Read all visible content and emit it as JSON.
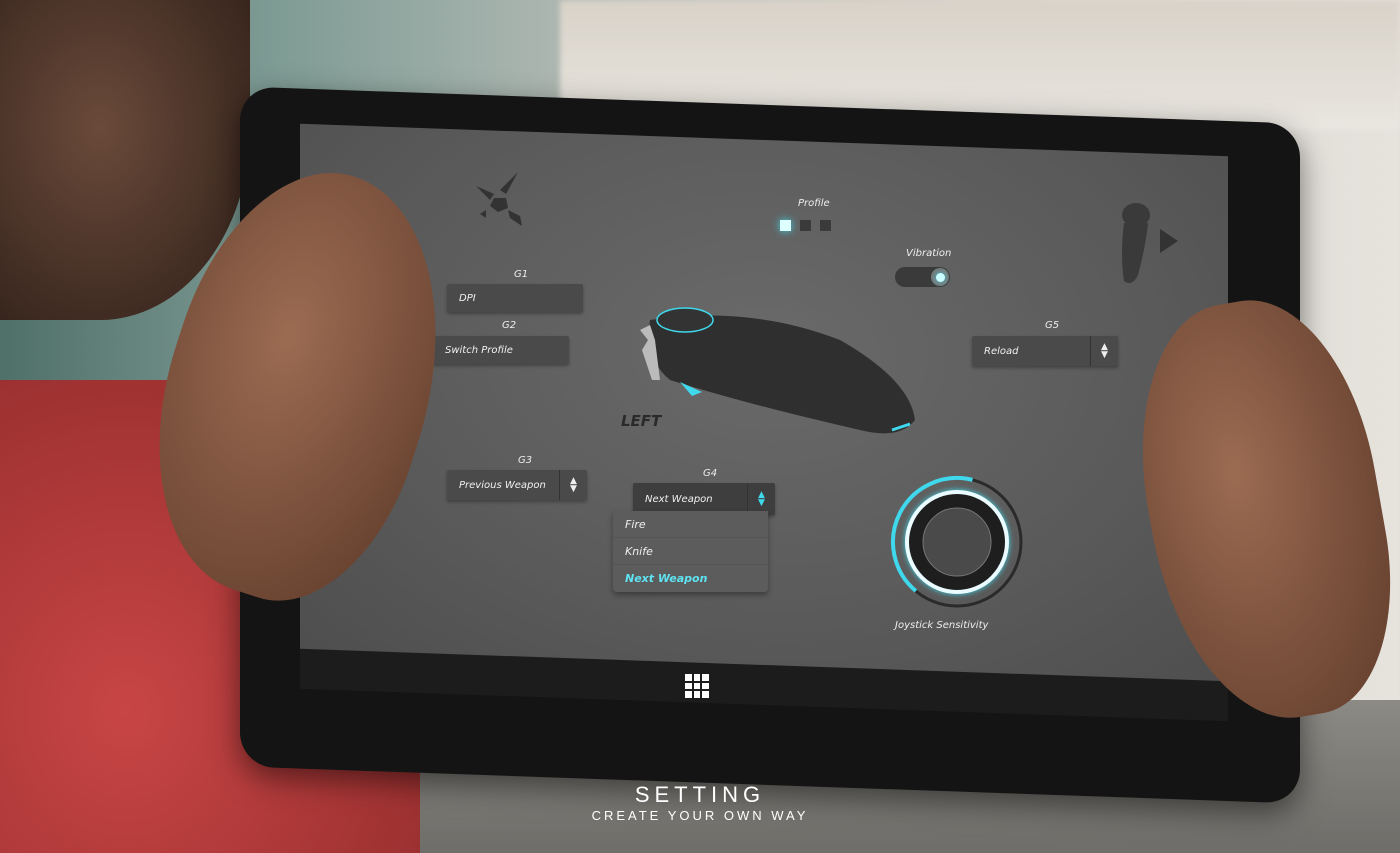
{
  "profile": {
    "label": "Profile",
    "count": 3,
    "active_index": 0
  },
  "vibration": {
    "label": "Vibration",
    "on": true
  },
  "g1": {
    "label": "G1",
    "value": "DPI"
  },
  "g2": {
    "label": "G2",
    "value": "Switch Profile"
  },
  "g3": {
    "label": "G3",
    "value": "Previous Weapon"
  },
  "g4": {
    "label": "G4",
    "value": "Next Weapon",
    "options": [
      "Fire",
      "Knife",
      "Next Weapon"
    ],
    "selected": "Next Weapon"
  },
  "g5": {
    "label": "G5",
    "value": "Reload"
  },
  "side_label": "LEFT",
  "joystick": {
    "label": "Joystick Sensitivity",
    "level": 0.55
  },
  "caption": {
    "title": "SETTING",
    "subtitle": "CREATE YOUR OWN WAY"
  },
  "colors": {
    "accent": "#3fd8ec",
    "screen": "#5f5f5f",
    "field": "#4a4a4a"
  },
  "icons": {
    "logo": "x-logo-icon",
    "controller": "controller-side-icon",
    "play": "play-icon",
    "start": "start-grid-icon"
  }
}
